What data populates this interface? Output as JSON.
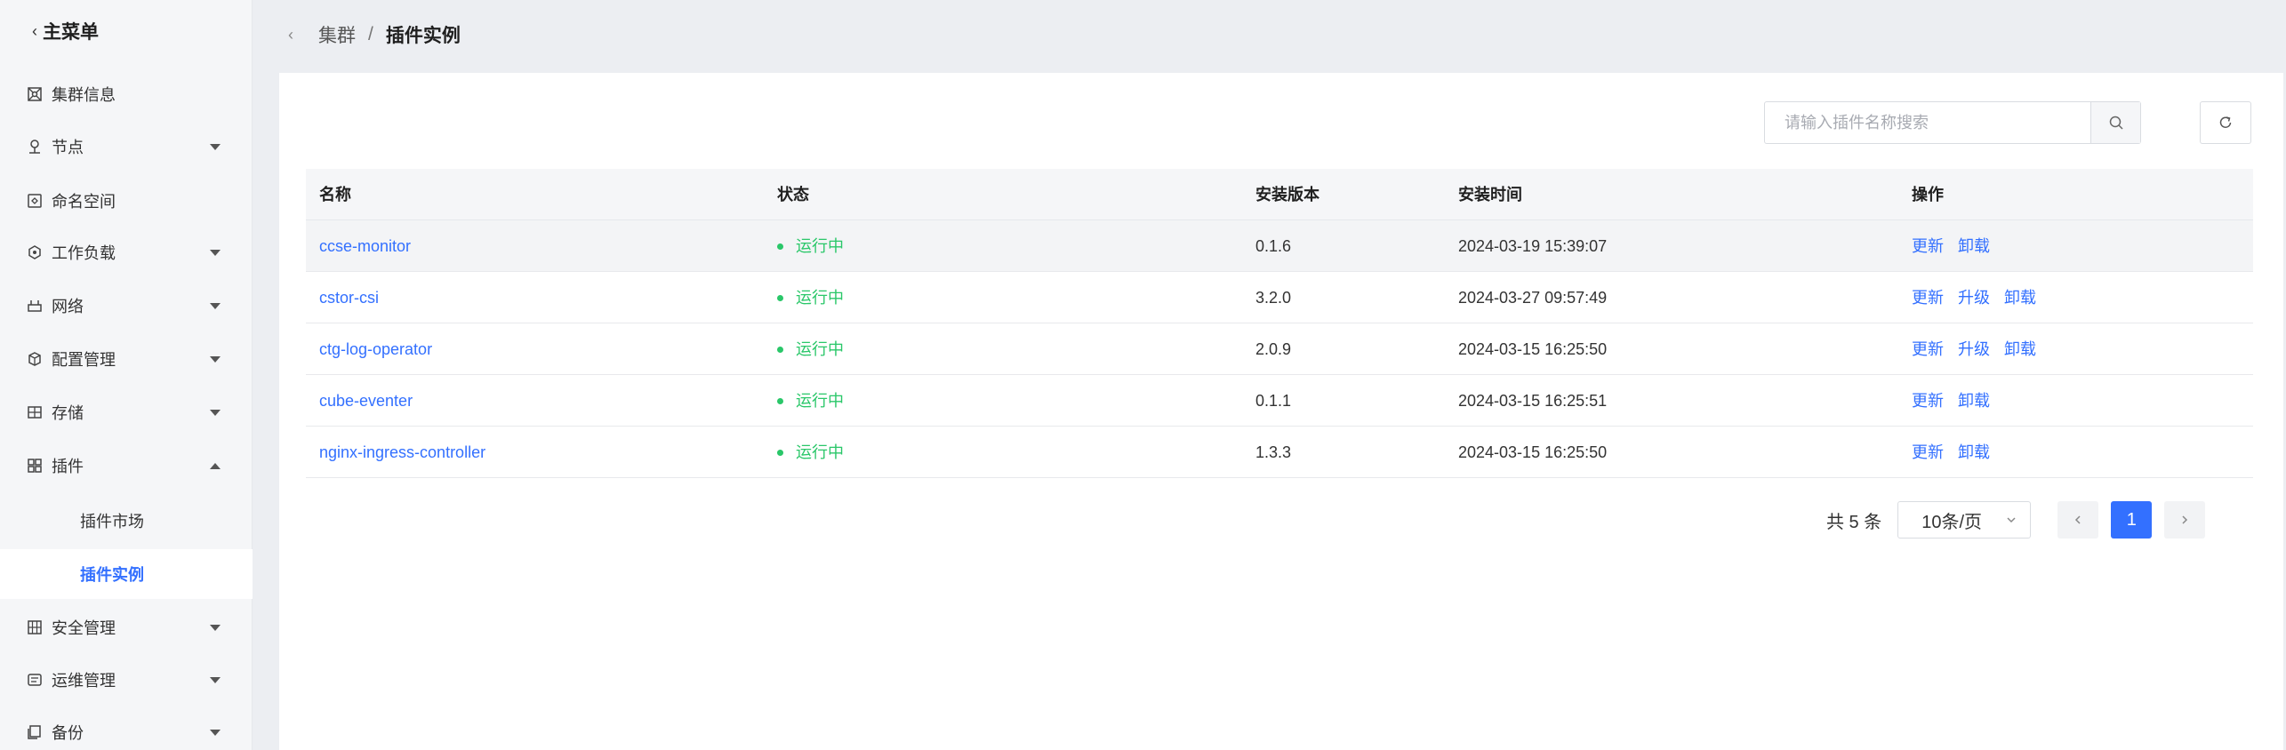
{
  "sidebar": {
    "title": "主菜单",
    "items": [
      {
        "label": "集群信息",
        "icon": "cluster-icon"
      },
      {
        "label": "节点",
        "icon": "node-icon"
      },
      {
        "label": "命名空间",
        "icon": "namespace-icon"
      },
      {
        "label": "工作负载",
        "icon": "workload-icon"
      },
      {
        "label": "网络",
        "icon": "network-icon"
      },
      {
        "label": "配置管理",
        "icon": "config-icon"
      },
      {
        "label": "存储",
        "icon": "storage-icon"
      },
      {
        "label": "插件",
        "icon": "plugin-icon"
      },
      {
        "label": "插件市场"
      },
      {
        "label": "插件实例"
      },
      {
        "label": "安全管理",
        "icon": "security-icon"
      },
      {
        "label": "运维管理",
        "icon": "ops-icon"
      },
      {
        "label": "备份",
        "icon": "backup-icon"
      }
    ]
  },
  "breadcrumb": {
    "parent": "集群",
    "separator": "/",
    "current": "插件实例"
  },
  "search": {
    "placeholder": "请输入插件名称搜索"
  },
  "table": {
    "headers": {
      "name": "名称",
      "status": "状态",
      "version": "安装版本",
      "time": "安装时间",
      "ops": "操作"
    },
    "rows": [
      {
        "name": "ccse-monitor",
        "status": "运行中",
        "version": "0.1.6",
        "time": "2024-03-19 15:39:07",
        "ops": [
          "更新",
          "卸载"
        ]
      },
      {
        "name": "cstor-csi",
        "status": "运行中",
        "version": "3.2.0",
        "time": "2024-03-27 09:57:49",
        "ops": [
          "更新",
          "升级",
          "卸载"
        ]
      },
      {
        "name": "ctg-log-operator",
        "status": "运行中",
        "version": "2.0.9",
        "time": "2024-03-15 16:25:50",
        "ops": [
          "更新",
          "升级",
          "卸载"
        ]
      },
      {
        "name": "cube-eventer",
        "status": "运行中",
        "version": "0.1.1",
        "time": "2024-03-15 16:25:51",
        "ops": [
          "更新",
          "卸载"
        ]
      },
      {
        "name": "nginx-ingress-controller",
        "status": "运行中",
        "version": "1.3.3",
        "time": "2024-03-15 16:25:50",
        "ops": [
          "更新",
          "卸载"
        ]
      }
    ]
  },
  "pagination": {
    "total": "共 5 条",
    "page_size": "10条/页",
    "current_page": "1"
  },
  "colors": {
    "accent": "#3370ff",
    "status_running": "#2ac769"
  }
}
